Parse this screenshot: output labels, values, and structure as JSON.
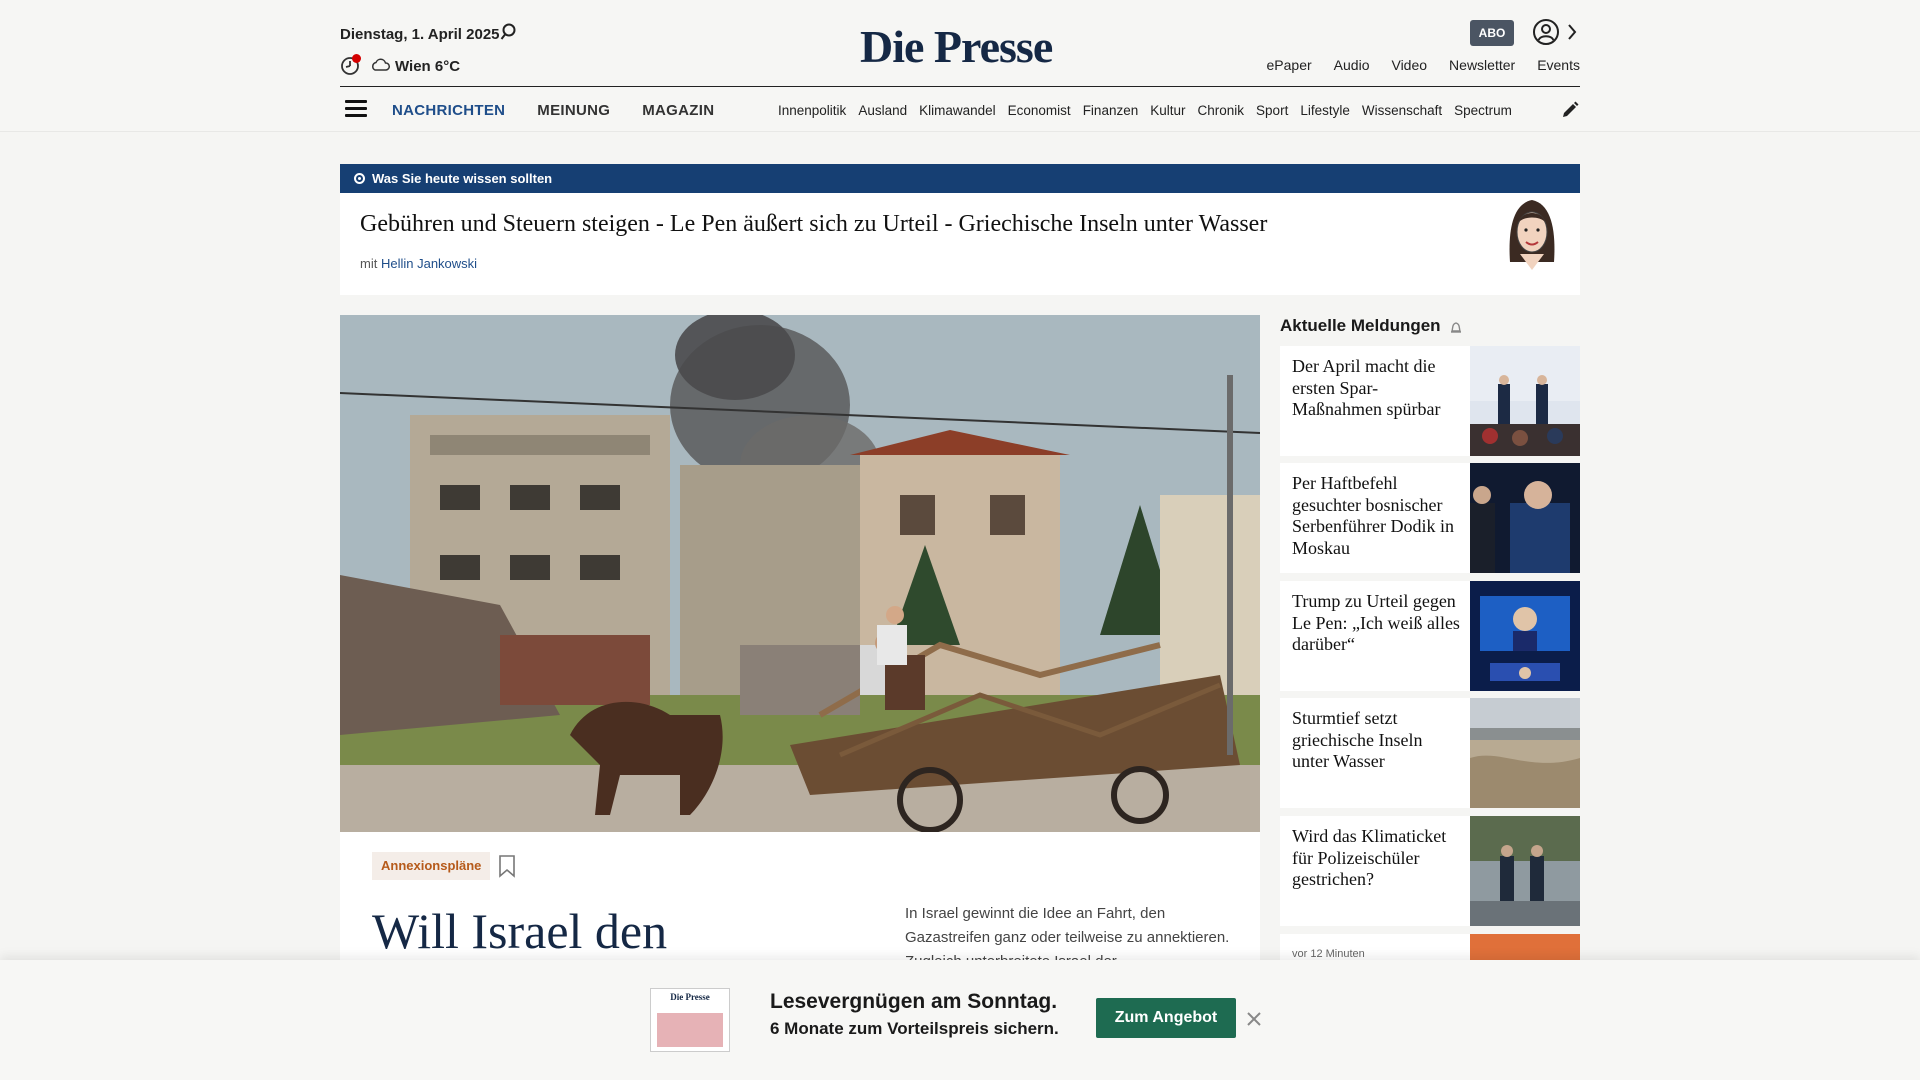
{
  "header": {
    "date": "Dienstag, 1. April 2025",
    "weather": "Wien 6°C",
    "logo": "Die Presse",
    "abo_label": "ABO",
    "top_links": [
      "ePaper",
      "Audio",
      "Video",
      "Newsletter",
      "Events"
    ],
    "main_nav": [
      "NACHRICHTEN",
      "MEINUNG",
      "MAGAZIN"
    ],
    "sub_nav": [
      "Innenpolitik",
      "Ausland",
      "Klimawandel",
      "Economist",
      "Finanzen",
      "Kultur",
      "Chronik",
      "Sport",
      "Lifestyle",
      "Wissenschaft",
      "Spectrum"
    ]
  },
  "briefing": {
    "label": "Was Sie heute wissen sollten",
    "headline": "Gebühren und Steuern steigen - Le Pen äußert sich zu Urteil - Griechische Inseln unter Wasser",
    "author_prefix": "mit",
    "author": "Hellin Jankowski"
  },
  "article": {
    "tag": "Annexionspläne",
    "title": "Will Israel den",
    "teaser": "In Israel gewinnt die Idee an Fahrt, den Gazastreifen ganz oder teilweise zu annektieren. Zugleich unterbreitete Israel der"
  },
  "sidebar": {
    "title": "Aktuelle Meldungen",
    "items": [
      {
        "text": "Der April macht die ersten Spar-Maßnahmen spürbar"
      },
      {
        "text": "Per Haftbefehl gesuchter bosnischer Serbenführer Dodik in Moskau"
      },
      {
        "text": "Trump zu Urteil gegen Le Pen: „Ich weiß alles darüber“"
      },
      {
        "text": "Sturmtief setzt griechische Inseln unter Wasser"
      },
      {
        "text": "Wird das Klimaticket für Polizeischüler gestrichen?"
      }
    ],
    "last_meta": "vor 12 Minuten"
  },
  "overlay": {
    "cover_logo": "Die Presse",
    "line1": "Lesevergnügen am Sonntag.",
    "line2": "6 Monate zum Vorteilspreis sichern.",
    "button": "Zum Angebot"
  },
  "colors": {
    "brand_navy": "#152845",
    "nav_active": "#1f4e8a",
    "briefing_bar": "#163f73",
    "cta_green": "#1e6b51",
    "tag_orange": "#b65a1a"
  }
}
